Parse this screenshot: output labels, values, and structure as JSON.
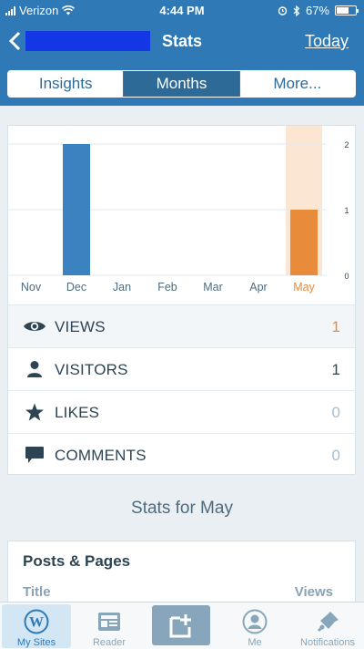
{
  "status_bar": {
    "carrier": "Verizon",
    "time": "4:44 PM",
    "battery": "67%",
    "battery_level": 0.67
  },
  "nav": {
    "title": "Stats",
    "today_label": "Today",
    "back_icon": "chevron-left-icon"
  },
  "segments": [
    {
      "label": "Insights",
      "active": false
    },
    {
      "label": "Months",
      "active": true
    },
    {
      "label": "More...",
      "active": false
    }
  ],
  "chart_data": {
    "type": "bar",
    "categories": [
      "Nov",
      "Dec",
      "Jan",
      "Feb",
      "Mar",
      "Apr",
      "May"
    ],
    "values": [
      0,
      2,
      0,
      0,
      0,
      0,
      1
    ],
    "selected_category": "May",
    "ylim": [
      0,
      2
    ],
    "y_ticks": [
      "2",
      "1",
      "0"
    ],
    "grid": true,
    "colors": {
      "bar": "#3a82c0",
      "selected_bar": "#e88b3a",
      "selected_band": "#fbe6d4"
    }
  },
  "stats": [
    {
      "label": "VIEWS",
      "value": "1",
      "icon": "eye-icon"
    },
    {
      "label": "VISITORS",
      "value": "1",
      "icon": "person-icon"
    },
    {
      "label": "LIKES",
      "value": "0",
      "icon": "star-icon"
    },
    {
      "label": "COMMENTS",
      "value": "0",
      "icon": "comment-icon"
    }
  ],
  "section_heading": "Stats for May",
  "posts": {
    "title": "Posts & Pages",
    "col_title": "Title",
    "col_views": "Views"
  },
  "tabs": [
    {
      "label": "My Sites",
      "icon": "wordpress-icon"
    },
    {
      "label": "Reader",
      "icon": "reader-icon"
    },
    {
      "label": "",
      "icon": "write-icon"
    },
    {
      "label": "Me",
      "icon": "me-icon"
    },
    {
      "label": "Notifications",
      "icon": "bell-icon"
    }
  ],
  "colors": {
    "brand": "#2e79b6",
    "accent": "#e88b3a"
  }
}
